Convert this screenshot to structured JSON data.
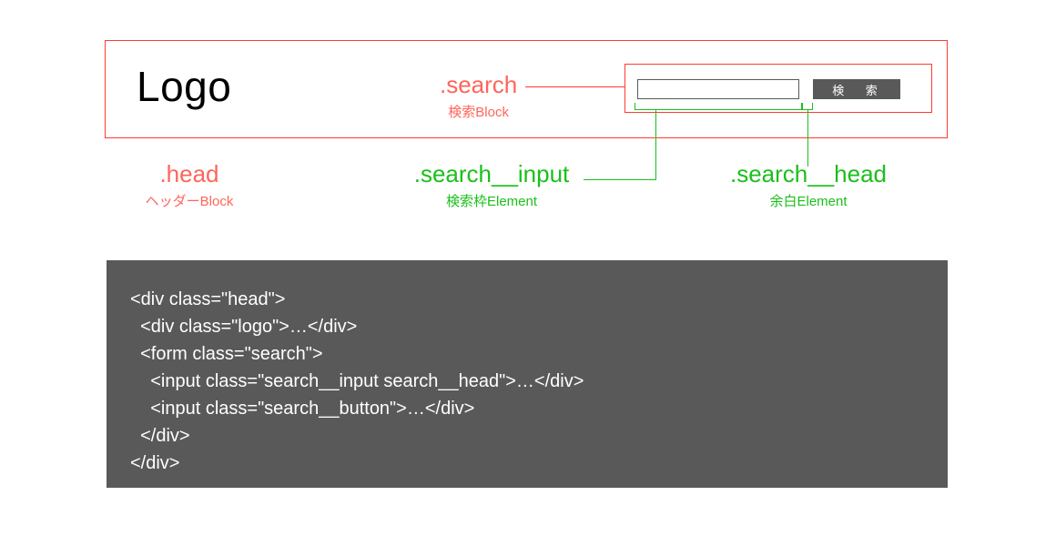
{
  "head": {
    "logo_text": "Logo",
    "search_button_label": "検 索"
  },
  "annotations": {
    "search": {
      "class_name": ".search",
      "description": "検索Block"
    },
    "head": {
      "class_name": ".head",
      "description": "ヘッダーBlock"
    },
    "search_input": {
      "class_name": ".search__input",
      "description": "検索枠Element"
    },
    "search_head": {
      "class_name": ".search__head",
      "description": "余白Element"
    }
  },
  "code": {
    "line1": "<div class=\"head\">",
    "line2": "  <div class=\"logo\">…</div>",
    "line3": "  <form class=\"search\">",
    "line4": "    <input class=\"search__input search__head\">…</div>",
    "line5": "    <input class=\"search__button\">…</div>",
    "line6": "  </div>",
    "line7": "</div>"
  },
  "colors": {
    "annotation_red": "#ff655b",
    "annotation_green": "#1bbf1b",
    "code_bg": "#595959"
  }
}
